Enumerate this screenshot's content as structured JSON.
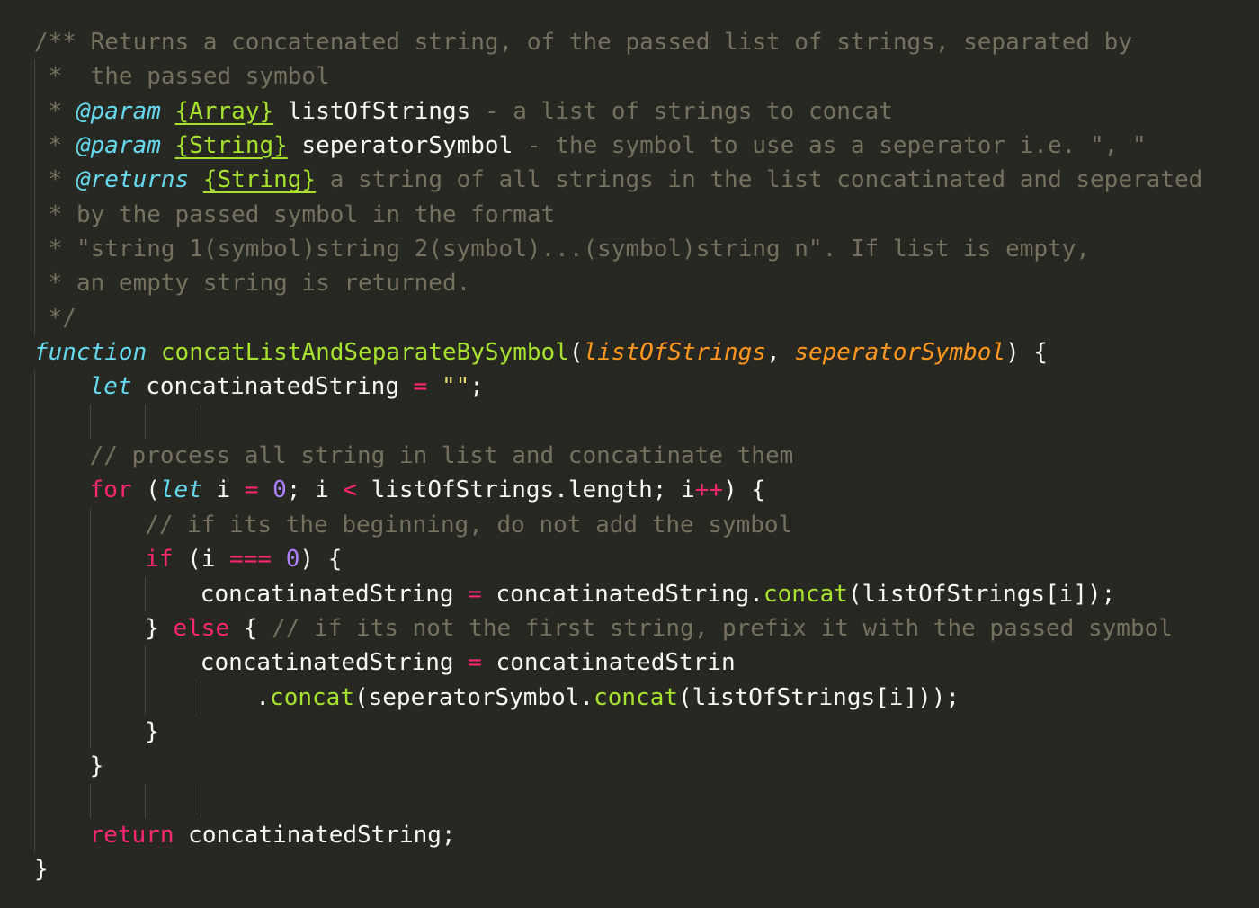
{
  "editor": {
    "theme": "monokai",
    "colors": {
      "background": "#272822",
      "comment": "#75715e",
      "jsdoc_tag": "#66d9ef",
      "jsdoc_type": "#a6e22e",
      "keyword": "#f92672",
      "storage": "#66d9ef",
      "function_name": "#a6e22e",
      "parameter": "#fd971f",
      "number": "#ae81ff",
      "string": "#e6db74",
      "text": "#f8f8f2",
      "indent_guide": "#464741"
    },
    "lines": [
      {
        "indent": 0,
        "tokens": [
          {
            "t": "comment",
            "v": "/** Returns a concatenated string, of the passed list of strings, separated by"
          }
        ]
      },
      {
        "indent": 0,
        "tokens": [
          {
            "t": "comment",
            "v": " *  the passed symbol"
          }
        ]
      },
      {
        "indent": 0,
        "tokens": [
          {
            "t": "comment",
            "v": " * "
          },
          {
            "t": "tag",
            "v": "@param"
          },
          {
            "t": "comment",
            "v": " "
          },
          {
            "t": "type",
            "v": "{Array}"
          },
          {
            "t": "plain",
            "v": " listOfStrings"
          },
          {
            "t": "comment",
            "v": " - a list of strings to concat"
          }
        ]
      },
      {
        "indent": 0,
        "tokens": [
          {
            "t": "comment",
            "v": " * "
          },
          {
            "t": "tag",
            "v": "@param"
          },
          {
            "t": "comment",
            "v": " "
          },
          {
            "t": "type",
            "v": "{String}"
          },
          {
            "t": "plain",
            "v": " seperatorSymbol"
          },
          {
            "t": "comment",
            "v": " - the symbol to use as a seperator i.e. \", \""
          }
        ]
      },
      {
        "indent": 0,
        "tokens": [
          {
            "t": "comment",
            "v": " * "
          },
          {
            "t": "tag",
            "v": "@returns"
          },
          {
            "t": "comment",
            "v": " "
          },
          {
            "t": "type",
            "v": "{String}"
          },
          {
            "t": "comment",
            "v": " a string of all strings in the list concatinated and seperated"
          }
        ]
      },
      {
        "indent": 0,
        "tokens": [
          {
            "t": "comment",
            "v": " * by the passed symbol in the format"
          }
        ]
      },
      {
        "indent": 0,
        "tokens": [
          {
            "t": "comment",
            "v": " * \"string 1(symbol)string 2(symbol)...(symbol)string n\". If list is empty,"
          }
        ]
      },
      {
        "indent": 0,
        "tokens": [
          {
            "t": "comment",
            "v": " * an empty string is returned."
          }
        ]
      },
      {
        "indent": 0,
        "tokens": [
          {
            "t": "comment",
            "v": " */"
          }
        ]
      },
      {
        "indent": 0,
        "tokens": [
          {
            "t": "storage",
            "v": "function"
          },
          {
            "t": "plain",
            "v": " "
          },
          {
            "t": "func",
            "v": "concatListAndSeparateBySymbol"
          },
          {
            "t": "plain",
            "v": "("
          },
          {
            "t": "param",
            "v": "listOfStrings"
          },
          {
            "t": "plain",
            "v": ", "
          },
          {
            "t": "param",
            "v": "seperatorSymbol"
          },
          {
            "t": "plain",
            "v": ") {"
          }
        ]
      },
      {
        "indent": 1,
        "tokens": [
          {
            "t": "storage",
            "v": "let"
          },
          {
            "t": "plain",
            "v": " concatinatedString "
          },
          {
            "t": "op",
            "v": "="
          },
          {
            "t": "plain",
            "v": " "
          },
          {
            "t": "str",
            "v": "\"\""
          },
          {
            "t": "plain",
            "v": ";"
          }
        ]
      },
      {
        "indent": 0,
        "tokens": []
      },
      {
        "indent": 1,
        "tokens": [
          {
            "t": "comment",
            "v": "// process all string in list and concatinate them"
          }
        ]
      },
      {
        "indent": 1,
        "tokens": [
          {
            "t": "keyword",
            "v": "for"
          },
          {
            "t": "plain",
            "v": " ("
          },
          {
            "t": "storage",
            "v": "let"
          },
          {
            "t": "plain",
            "v": " i "
          },
          {
            "t": "op",
            "v": "="
          },
          {
            "t": "plain",
            "v": " "
          },
          {
            "t": "num",
            "v": "0"
          },
          {
            "t": "plain",
            "v": "; i "
          },
          {
            "t": "op",
            "v": "<"
          },
          {
            "t": "plain",
            "v": " listOfStrings.length; i"
          },
          {
            "t": "op",
            "v": "++"
          },
          {
            "t": "plain",
            "v": ") {"
          }
        ]
      },
      {
        "indent": 2,
        "tokens": [
          {
            "t": "comment",
            "v": "// if its the beginning, do not add the symbol"
          }
        ]
      },
      {
        "indent": 2,
        "tokens": [
          {
            "t": "keyword",
            "v": "if"
          },
          {
            "t": "plain",
            "v": " (i "
          },
          {
            "t": "op",
            "v": "==="
          },
          {
            "t": "plain",
            "v": " "
          },
          {
            "t": "num",
            "v": "0"
          },
          {
            "t": "plain",
            "v": ") {"
          }
        ]
      },
      {
        "indent": 3,
        "tokens": [
          {
            "t": "plain",
            "v": "concatinatedString "
          },
          {
            "t": "op",
            "v": "="
          },
          {
            "t": "plain",
            "v": " concatinatedString."
          },
          {
            "t": "method",
            "v": "concat"
          },
          {
            "t": "plain",
            "v": "(listOfStrings[i]);"
          }
        ]
      },
      {
        "indent": 2,
        "tokens": [
          {
            "t": "plain",
            "v": "} "
          },
          {
            "t": "keyword",
            "v": "else"
          },
          {
            "t": "plain",
            "v": " { "
          },
          {
            "t": "comment",
            "v": "// if its not the first string, prefix it with the passed symbol"
          }
        ]
      },
      {
        "indent": 3,
        "tokens": [
          {
            "t": "plain",
            "v": "concatinatedString "
          },
          {
            "t": "op",
            "v": "="
          },
          {
            "t": "plain",
            "v": " concatinatedStrin"
          }
        ]
      },
      {
        "indent": 4,
        "tokens": [
          {
            "t": "plain",
            "v": "."
          },
          {
            "t": "method",
            "v": "concat"
          },
          {
            "t": "plain",
            "v": "(seperatorSymbol."
          },
          {
            "t": "method",
            "v": "concat"
          },
          {
            "t": "plain",
            "v": "(listOfStrings[i]));"
          }
        ]
      },
      {
        "indent": 2,
        "tokens": [
          {
            "t": "plain",
            "v": "}"
          }
        ]
      },
      {
        "indent": 1,
        "tokens": [
          {
            "t": "plain",
            "v": "}"
          }
        ]
      },
      {
        "indent": 0,
        "tokens": []
      },
      {
        "indent": 1,
        "tokens": [
          {
            "t": "keyword",
            "v": "return"
          },
          {
            "t": "plain",
            "v": " concatinatedString;"
          }
        ]
      },
      {
        "indent": 0,
        "tokens": [
          {
            "t": "plain",
            "v": "}"
          }
        ]
      }
    ]
  }
}
